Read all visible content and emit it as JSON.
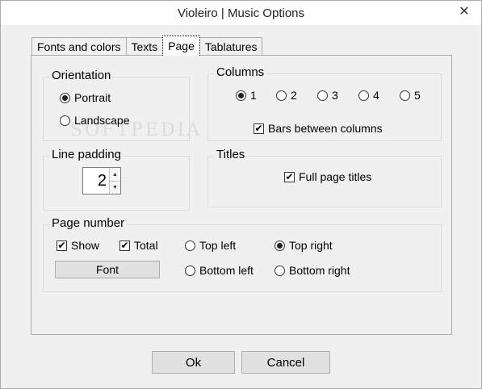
{
  "window": {
    "title": "Violeiro | Music Options",
    "close_glyph": "✕"
  },
  "tabs": [
    {
      "label": "Fonts and colors"
    },
    {
      "label": "Texts"
    },
    {
      "label": "Page"
    },
    {
      "label": "Tablatures"
    }
  ],
  "orientation": {
    "title": "Orientation",
    "options": [
      {
        "label": "Portrait"
      },
      {
        "label": "Landscape"
      }
    ],
    "selected": "Portrait"
  },
  "columns": {
    "title": "Columns",
    "options": [
      {
        "label": "1"
      },
      {
        "label": "2"
      },
      {
        "label": "3"
      },
      {
        "label": "4"
      },
      {
        "label": "5"
      }
    ],
    "selected": "1",
    "bars_between_label": "Bars between columns",
    "bars_between_checked": true
  },
  "line_padding": {
    "title": "Line padding",
    "value": "2",
    "up_glyph": "▲",
    "down_glyph": "▼"
  },
  "titles": {
    "title": "Titles",
    "full_page_label": "Full page titles",
    "full_page_checked": true
  },
  "page_number": {
    "title": "Page number",
    "show_label": "Show",
    "show_checked": true,
    "total_label": "Total",
    "total_checked": true,
    "font_button": "Font",
    "positions": [
      {
        "label": "Top left"
      },
      {
        "label": "Top right"
      },
      {
        "label": "Bottom left"
      },
      {
        "label": "Bottom right"
      }
    ],
    "selected": "Top right"
  },
  "buttons": {
    "ok": "Ok",
    "cancel": "Cancel"
  },
  "check_glyph": "✔",
  "watermark": "SOFTPEDIA"
}
